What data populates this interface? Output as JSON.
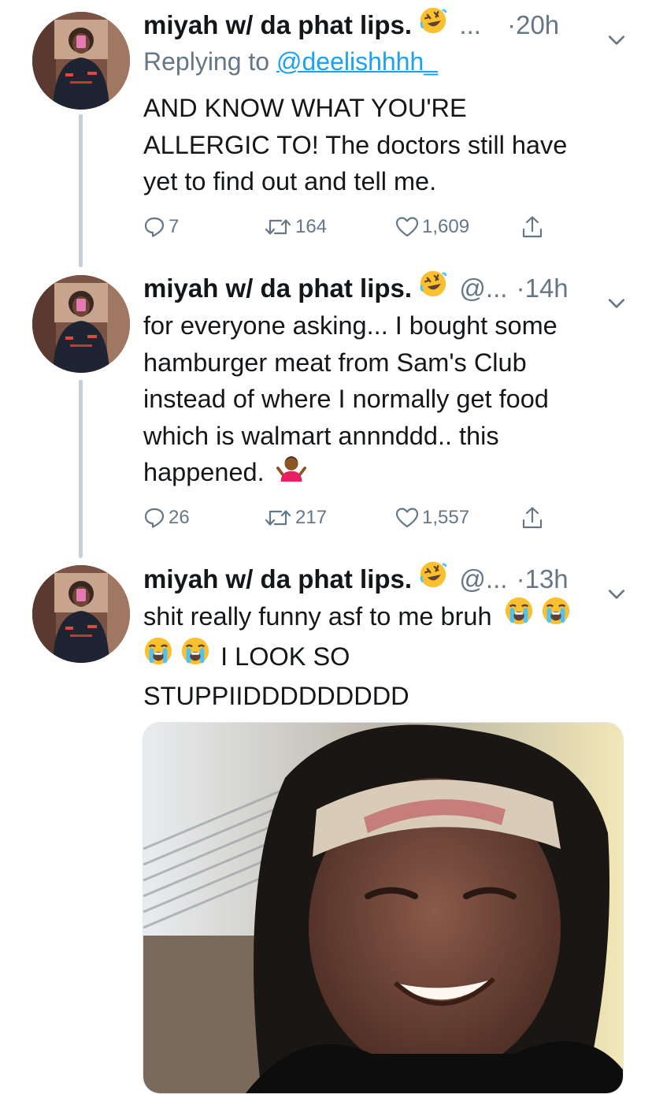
{
  "tweets": [
    {
      "name": "miyah w/ da phat lips.",
      "emoji": "rofl-emoji",
      "handle": "...",
      "time": "·20h",
      "reply_prefix": "Replying to ",
      "reply_handle": "@deelishhhh_",
      "lines": [
        "AND KNOW WHAT YOU'RE",
        "ALLERGIC TO! The doctors still have",
        "yet to find out and tell me."
      ],
      "replies": "7",
      "retweets": "164",
      "likes": "1,609"
    },
    {
      "name": "miyah w/ da phat lips.",
      "emoji": "rofl-emoji",
      "handle": "@...",
      "time": "·14h",
      "lines": [
        "for everyone asking... I bought some",
        "hamburger meat from Sam's Club",
        "instead of where I normally get food",
        "which is walmart annnddd.. this",
        "happened."
      ],
      "trailing_emoji": "shrug-emoji",
      "replies": "26",
      "retweets": "217",
      "likes": "1,557"
    },
    {
      "name": "miyah w/ da phat lips.",
      "emoji": "rofl-emoji",
      "handle": "@...",
      "time": "·13h",
      "lines": [
        "shit really funny asf to me bruh",
        "I LOOK SO",
        "STUPPIIDDDDDDDDD"
      ],
      "inline_emoji": "crying-emoji",
      "media": "photo"
    }
  ],
  "colors": {
    "text": "#14171a",
    "muted": "#657786",
    "link": "#1da1f2",
    "thread_line": "#c6d0d8"
  }
}
